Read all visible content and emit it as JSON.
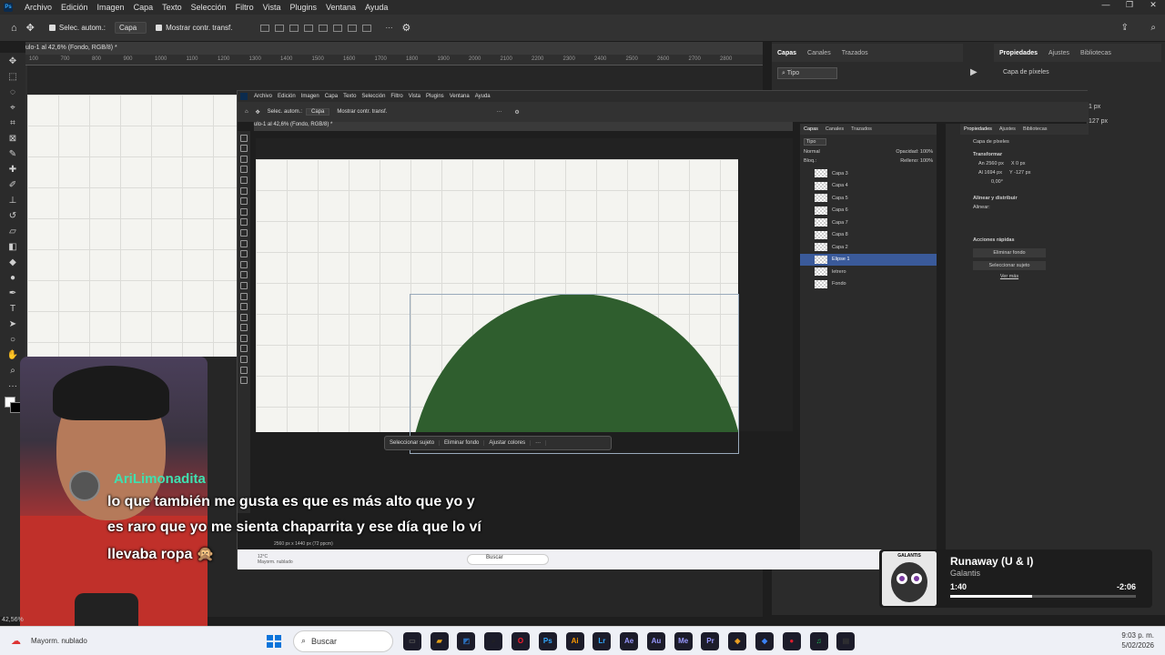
{
  "app": {
    "menu": [
      "Archivo",
      "Edición",
      "Imagen",
      "Capa",
      "Texto",
      "Selección",
      "Filtro",
      "Vista",
      "Plugins",
      "Ventana",
      "Ayuda"
    ],
    "window_controls": [
      "—",
      "❐",
      "✕"
    ]
  },
  "options": {
    "auto_select": "Selec. autom.:",
    "layer_dropdown": "Capa",
    "show_transform": "Mostrar contr. transf."
  },
  "document": {
    "tab_title": "ulo-1 al 42,6% (Fondo, RGB/8) *",
    "zoom": "42,56%",
    "ruler_ticks": [
      "100",
      "700",
      "800",
      "900",
      "1000",
      "1100",
      "1200",
      "1300",
      "1400",
      "1500",
      "1600",
      "1700",
      "1800",
      "1900",
      "2000",
      "2100",
      "2200",
      "2300",
      "2400",
      "2500",
      "2600",
      "2700",
      "2800"
    ]
  },
  "right_panels": {
    "layers_tabs": [
      "Capas",
      "Canales",
      "Trazados"
    ],
    "layers_filter": "Tipo",
    "props_tabs": [
      "Propiedades",
      "Ajustes",
      "Bibliotecas"
    ],
    "pixel_layer": "Capa de píxeles",
    "w_value": "1 px",
    "h_value": "127 px"
  },
  "inner": {
    "menu": [
      "Archivo",
      "Edición",
      "Imagen",
      "Capa",
      "Texto",
      "Selección",
      "Filtro",
      "Vista",
      "Plugins",
      "Ventana",
      "Ayuda"
    ],
    "auto_select": "Selec. autom.:",
    "layer_dropdown": "Capa",
    "show_transform": "Mostrar contr. transf.",
    "tab_title": "ulo-1 al 42,6% (Fondo, RGB/8) *",
    "context_bar": [
      "Seleccionar sujeto",
      "Eliminar fondo",
      "Ajustar colores"
    ],
    "layers": {
      "tabs": [
        "Capas",
        "Canales",
        "Trazados"
      ],
      "filter": "Tipo",
      "blend": "Normal",
      "opacity_label": "Opacidad:",
      "opacity": "100%",
      "lock_label": "Bloq.:",
      "fill_label": "Relleno:",
      "fill": "100%",
      "items": [
        {
          "name": "Capa 3",
          "selected": false
        },
        {
          "name": "Capa 4",
          "selected": false
        },
        {
          "name": "Capa 5",
          "selected": false
        },
        {
          "name": "Capa 6",
          "selected": false
        },
        {
          "name": "Capa 7",
          "selected": false
        },
        {
          "name": "Capa 8",
          "selected": false
        },
        {
          "name": "Capa 2",
          "selected": false
        },
        {
          "name": "Elipse 1",
          "selected": true
        },
        {
          "name": "letrero",
          "selected": false
        },
        {
          "name": "Fondo",
          "selected": false
        }
      ]
    },
    "props": {
      "tabs": [
        "Propiedades",
        "Ajustes",
        "Bibliotecas"
      ],
      "pixel_layer": "Capa de píxeles",
      "transform": "Transformar",
      "an": "An",
      "an_val": "2560 px",
      "al": "Al",
      "al_val": "1694 px",
      "x": "X",
      "x_val": "0 px",
      "y": "Y",
      "y_val": "-127 px",
      "angle": "0,00°",
      "align": "Alinear y distribuir",
      "align_label": "Alinear:",
      "quick": "Acciones rápidas",
      "remove_bg": "Eliminar fondo",
      "select_subject": "Seleccionar sujeto",
      "more": "Ver más"
    },
    "status": "2560 px x 1440 px (72 ppcm)",
    "weather_temp": "12°C",
    "weather": "Mayorm. nublado",
    "search": "Buscar"
  },
  "chat": {
    "username": "AriLimonadita",
    "lines": [
      "lo que también me gusta es que es más alto que yo y",
      "es raro que yo me sienta chaparrita y ese día que lo ví",
      "llevaba ropa 🙊"
    ]
  },
  "spotify": {
    "song": "Runaway (U & I)",
    "artist": "Galantis",
    "elapsed": "1:40",
    "remaining": "-2:06",
    "progress": 0.44,
    "art_label": "GALANTIS"
  },
  "taskbar": {
    "weather": "Mayorm. nublado",
    "search": "Buscar",
    "time": "9:03 p. m.",
    "date": "5/02/2026",
    "apps": [
      {
        "label": "▭",
        "color": "#555"
      },
      {
        "label": "▰",
        "color": "#e8a317"
      },
      {
        "label": "◩",
        "color": "#2a6ebb"
      },
      {
        "label": "⌕",
        "color": "#222"
      },
      {
        "label": "O",
        "color": "#ff1b2d"
      },
      {
        "label": "Ps",
        "color": "#31a8ff"
      },
      {
        "label": "Ai",
        "color": "#ff9a00"
      },
      {
        "label": "Lr",
        "color": "#31a8ff"
      },
      {
        "label": "Ae",
        "color": "#9999ff"
      },
      {
        "label": "Au",
        "color": "#9999ff"
      },
      {
        "label": "Me",
        "color": "#9999ff"
      },
      {
        "label": "Pr",
        "color": "#9999ff"
      },
      {
        "label": "◈",
        "color": "#f5a623"
      },
      {
        "label": "◆",
        "color": "#3b82f6"
      },
      {
        "label": "●",
        "color": "#e11d2e"
      },
      {
        "label": "♫",
        "color": "#1db954"
      },
      {
        "label": "▤",
        "color": "#333"
      }
    ]
  },
  "colors": {
    "ellipse": "#2f5e2e",
    "accent_selected": "#3a5a9a",
    "spotify_progress": "#ffffff"
  }
}
